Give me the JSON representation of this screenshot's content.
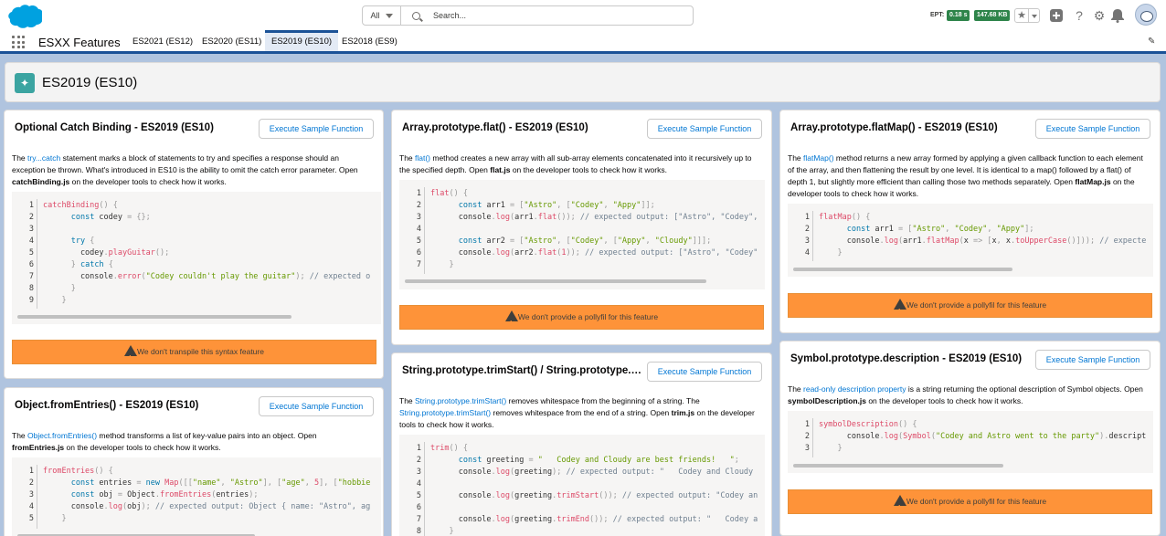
{
  "header": {
    "search_scope": "All",
    "search_placeholder": "Search...",
    "ept_label": "EPT:",
    "ept_time": "0.18 s",
    "ept_size": "147.68 KB"
  },
  "nav": {
    "app_name": "ESXX Features",
    "tabs": [
      {
        "label": "ES2021 (ES12)"
      },
      {
        "label": "ES2020 (ES11)"
      },
      {
        "label": "ES2019 (ES10)"
      },
      {
        "label": "ES2018 (ES9)"
      }
    ]
  },
  "page": {
    "title": "ES2019 (ES10)"
  },
  "button_label": "Execute Sample Function",
  "cards": {
    "catch": {
      "title": "Optional Catch Binding - ES2019 (ES10)",
      "desc_link": "try...catch",
      "desc_a": " statement marks a block of statements to try and specifies a response should an exception be thrown. What's introduced in ES10 is the ability to omit the catch error parameter. Open ",
      "desc_file": "catchBinding.js",
      "desc_b": " on the developer tools to check how it works.",
      "warning": "We don't transpile this syntax feature"
    },
    "flat": {
      "title": "Array.prototype.flat() - ES2019 (ES10)",
      "desc_link": "flat()",
      "desc_a": " method creates a new array with all sub-array elements concatenated into it recursively up to the specified depth. Open ",
      "desc_file": "flat.js",
      "desc_b": " on the developer tools to check how it works.",
      "warning": "We don't provide a pollyfil for this feature"
    },
    "flatmap": {
      "title": "Array.prototype.flatMap() - ES2019 (ES10)",
      "desc_link": "flatMap()",
      "desc_a": " method returns a new array formed by applying a given callback function to each element of the array, and then flattening the result by one level. It is identical to a map() followed by a flat() of depth 1, but slightly more efficient than calling those two methods separately. Open ",
      "desc_file": "flatMap.js",
      "desc_b": " on the developer tools to check how it works.",
      "warning": "We don't provide a pollyfil for this feature"
    },
    "trim": {
      "title": "String.prototype.trimStart() / String.prototype.trimEnd()",
      "desc_link1": "String.prototype.trimStart()",
      "desc_a": " removes whitespace from the beginning of a string. The ",
      "desc_link2": "String.prototype.trimStart()",
      "desc_b": " removes whitespace from the end of a string. Open ",
      "desc_file": "trim.js",
      "desc_c": " on the developer tools to check how it works."
    },
    "fromentries": {
      "title": "Object.fromEntries() - ES2019 (ES10)",
      "desc_link": "Object.fromEntries()",
      "desc_a": " method transforms a list of key-value pairs into an object. Open ",
      "desc_file": "fromEntries.js",
      "desc_b": " on the developer tools to check how it works."
    },
    "symbol": {
      "title": "Symbol.prototype.description - ES2019 (ES10)",
      "desc_link": "read-only description property",
      "desc_a": " is a string returning the optional description of Symbol objects. Open ",
      "desc_file": "symbolDescription.js",
      "desc_b": " on the developer tools to check how it works.",
      "warning": "We don't provide a pollyfil for this feature"
    }
  },
  "desc_prefix": "The "
}
